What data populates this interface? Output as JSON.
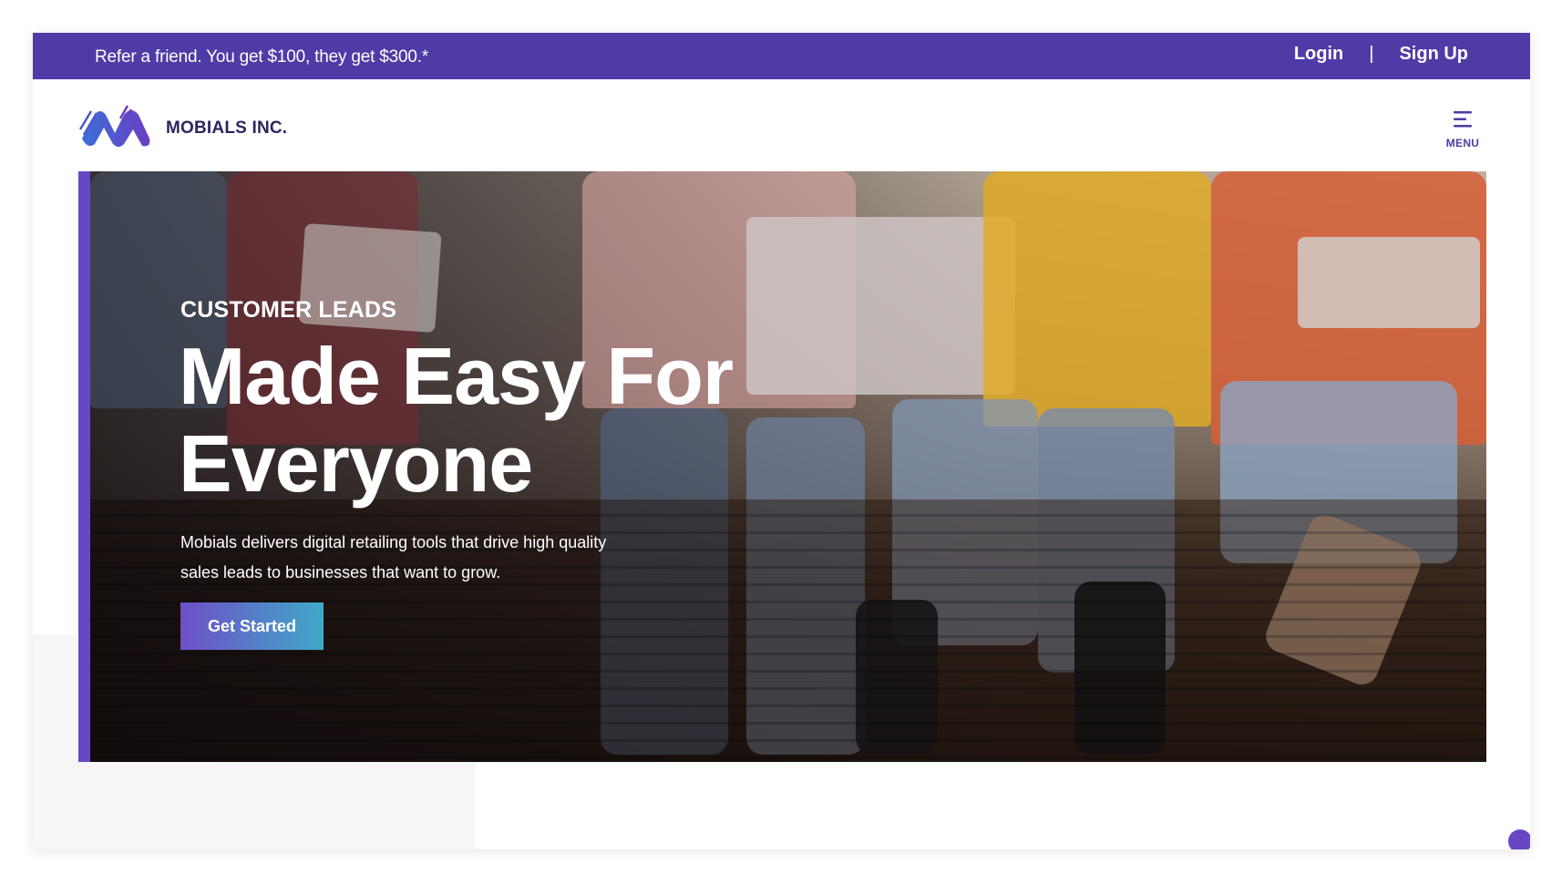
{
  "topbar": {
    "promo": "Refer a friend. You get $100, they get $300.*",
    "login": "Login",
    "separator": "|",
    "signup": "Sign Up"
  },
  "header": {
    "brand": "MOBIALS INC.",
    "menu_label": "MENU"
  },
  "hero": {
    "eyebrow": "CUSTOMER LEADS",
    "headline_line1": "Made Easy For",
    "headline_line2": "Everyone",
    "subtext": "Mobials delivers digital retailing tools that drive high quality sales leads to businesses that want to grow.",
    "cta": "Get Started"
  },
  "colors": {
    "brand_purple": "#4f3aa6",
    "accent_purple": "#6748c4",
    "cta_gradient_end": "#3fa9c9"
  },
  "icons": {
    "logo": "mobials-logo-icon",
    "menu": "hamburger-icon",
    "chat": "chat-bubble-icon"
  }
}
